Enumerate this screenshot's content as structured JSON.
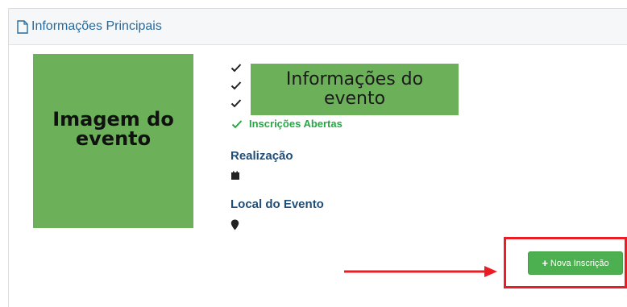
{
  "panel": {
    "title": "Informações Principais",
    "title_icon": "document-icon"
  },
  "event": {
    "image_placeholder": "Imagem do\nevento",
    "info_placeholder": "Informações do\nevento",
    "status": "Inscrições Abertas",
    "realizacao_label": "Realização",
    "local_label": "Local do Evento"
  },
  "actions": {
    "new_registration_label": "Nova Inscrição",
    "new_registration_icon": "plus-icon"
  },
  "colors": {
    "placeholder_green": "#6cb05a",
    "status_green": "#27a745",
    "button_green": "#4caf50",
    "label_blue": "#1f4e79",
    "highlight_red": "#ec1c24"
  }
}
